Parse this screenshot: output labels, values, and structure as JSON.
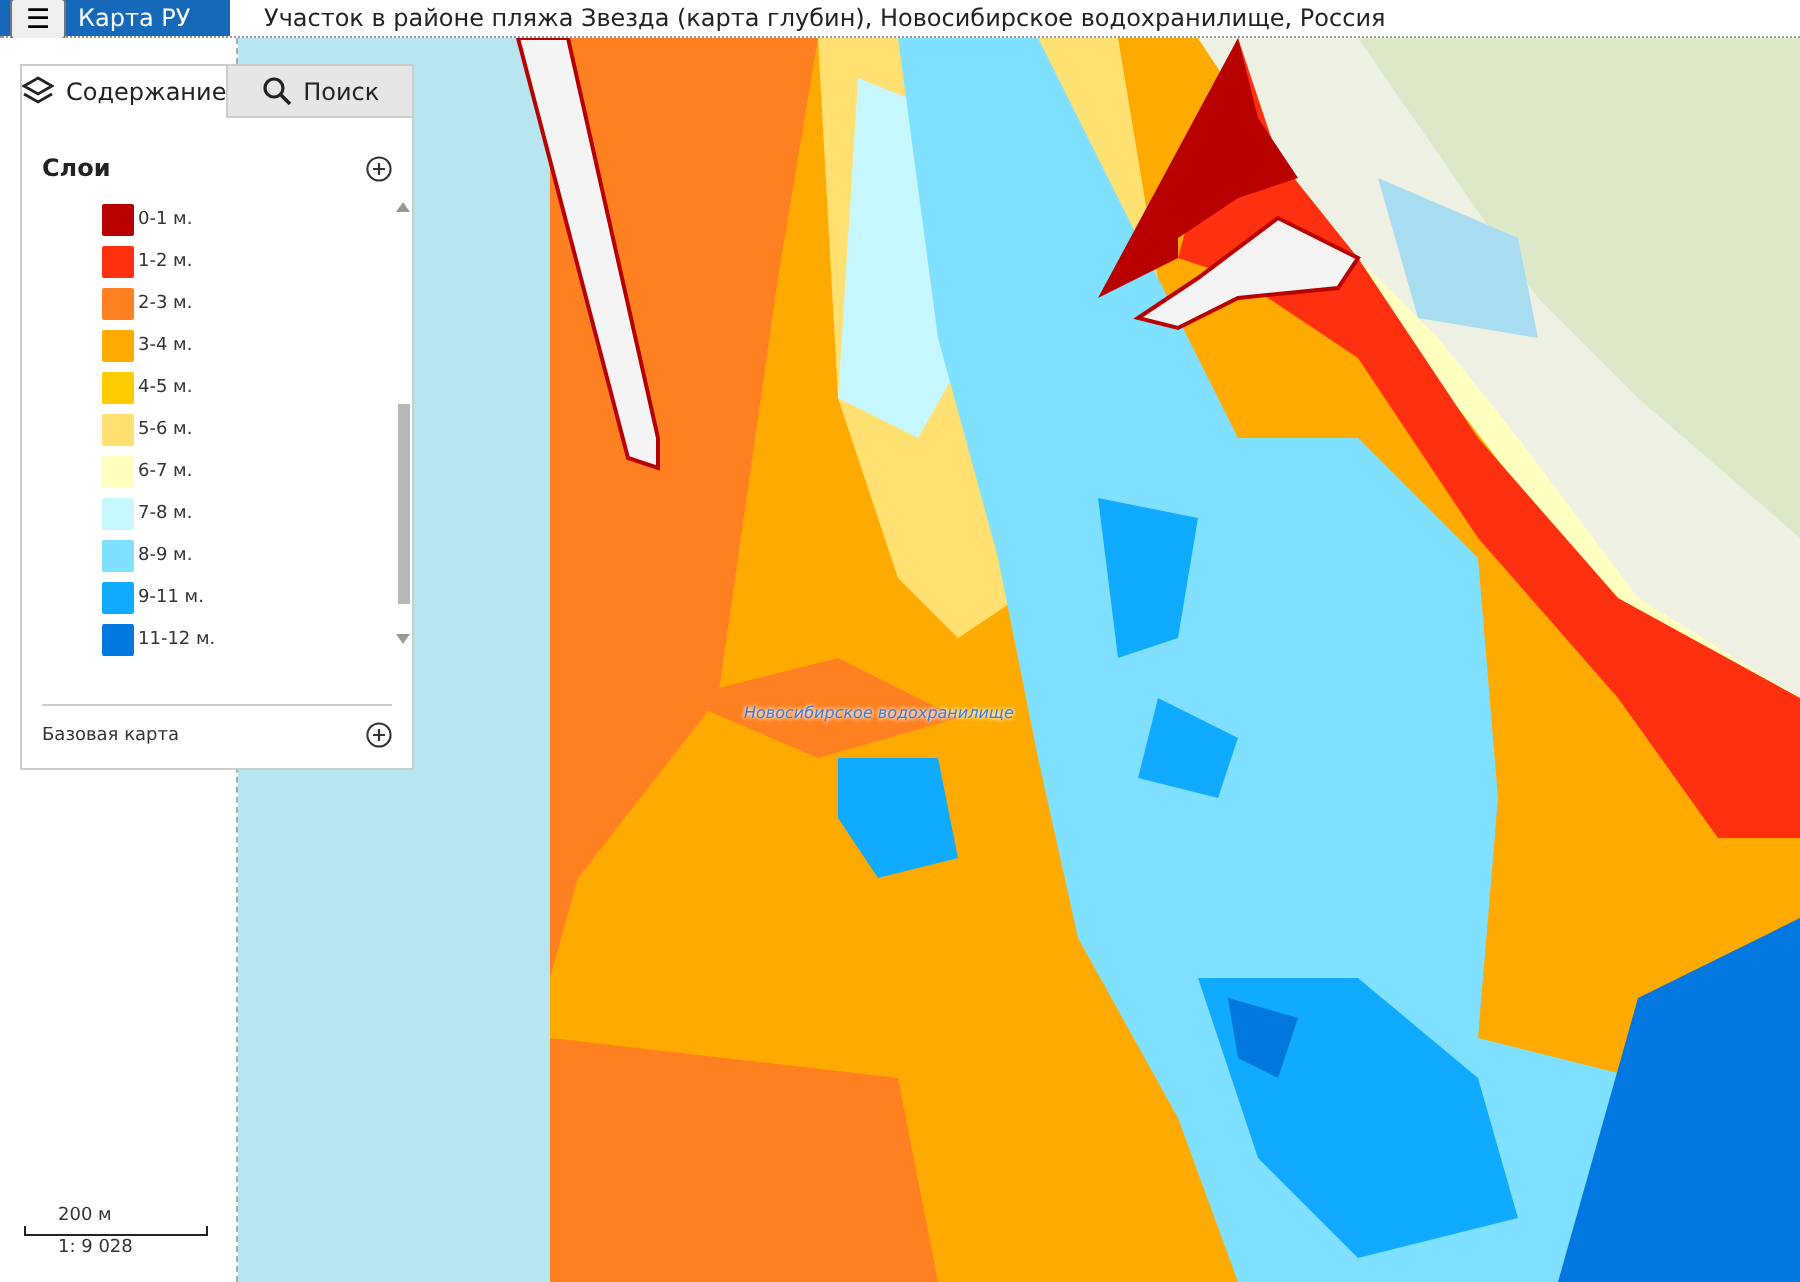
{
  "app_bar": {
    "menu_icon": "☰",
    "title": "Карта РУ"
  },
  "map_title": "Участок в районе пляжа Звезда (карта глубин), Новосибирское водохранилище, Россия",
  "panel": {
    "tabs": [
      {
        "label": "Содержание",
        "kind": "layers",
        "selected": true
      },
      {
        "label": "Поиск",
        "kind": "search",
        "selected": false
      }
    ],
    "layers_title": "Слои",
    "legend": [
      {
        "label": "0-1 м.",
        "color": "#b80000"
      },
      {
        "label": "1-2 м.",
        "color": "#ff3010"
      },
      {
        "label": "2-3 м.",
        "color": "#ff8020"
      },
      {
        "label": "3-4 м.",
        "color": "#ffaa00"
      },
      {
        "label": "4-5 м.",
        "color": "#ffcc00"
      },
      {
        "label": "5-6 м.",
        "color": "#ffe070"
      },
      {
        "label": "6-7 м.",
        "color": "#ffffc0"
      },
      {
        "label": "7-8 м.",
        "color": "#c8f8ff"
      },
      {
        "label": "8-9 м.",
        "color": "#80e0ff"
      },
      {
        "label": "9-11 м.",
        "color": "#10aaff"
      },
      {
        "label": "11-12 м.",
        "color": "#0078e0"
      }
    ],
    "basemap_title": "Базовая карта"
  },
  "scale": {
    "distance": "200 м",
    "ratio": "1: 9 028"
  },
  "map_label": "Новосибирское водохранилище"
}
